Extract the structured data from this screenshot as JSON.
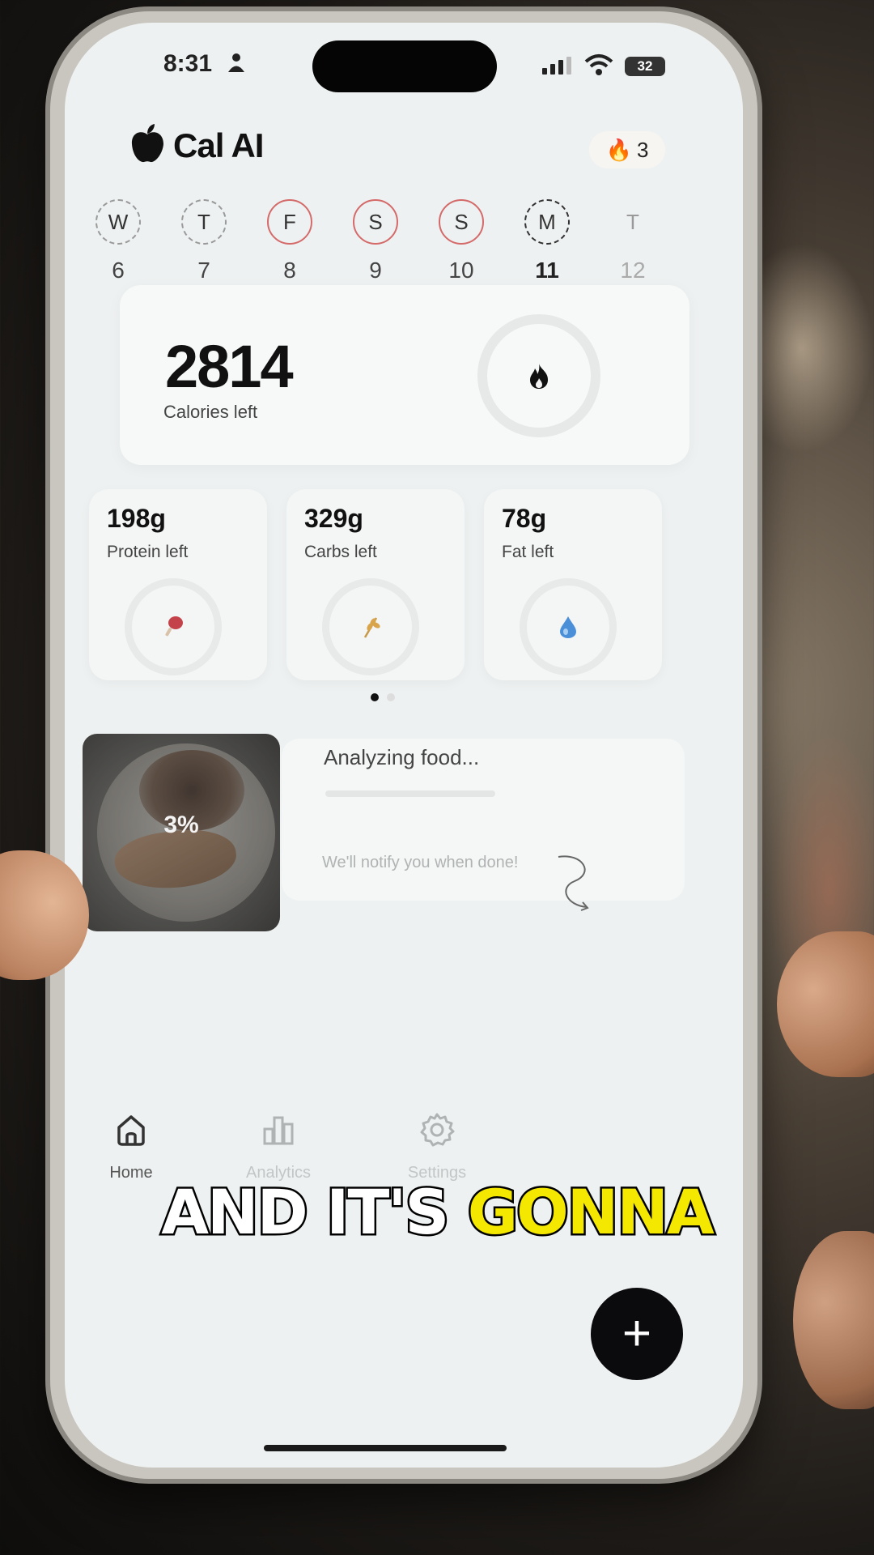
{
  "status_bar": {
    "time": "8:31",
    "battery": "32"
  },
  "header": {
    "app_name": "Cal AI",
    "streak_count": "3"
  },
  "days": [
    {
      "letter": "W",
      "num": "6",
      "style": "dashed"
    },
    {
      "letter": "T",
      "num": "7",
      "style": "dashed"
    },
    {
      "letter": "F",
      "num": "8",
      "style": "red"
    },
    {
      "letter": "S",
      "num": "9",
      "style": "red"
    },
    {
      "letter": "S",
      "num": "10",
      "style": "red"
    },
    {
      "letter": "M",
      "num": "11",
      "style": "selected"
    },
    {
      "letter": "T",
      "num": "12",
      "style": "future"
    }
  ],
  "calories": {
    "value": "2814",
    "label": "Calories left"
  },
  "macros": [
    {
      "value": "198g",
      "label": "Protein left",
      "icon": "drumstick-icon"
    },
    {
      "value": "329g",
      "label": "Carbs left",
      "icon": "wheat-icon"
    },
    {
      "value": "78g",
      "label": "Fat left",
      "icon": "drop-icon"
    }
  ],
  "analyzing": {
    "progress": "3%",
    "title": "Analyzing food...",
    "notify": "We'll notify you when done!"
  },
  "caption": {
    "part1": "AND IT'S",
    "part2": "GONNA"
  },
  "nav": {
    "home": "Home",
    "analytics": "Analytics",
    "settings": "Settings"
  },
  "colors": {
    "accent_red": "#d46a6a",
    "caption_yellow": "#f5e800",
    "fab": "#0b0b0d"
  }
}
